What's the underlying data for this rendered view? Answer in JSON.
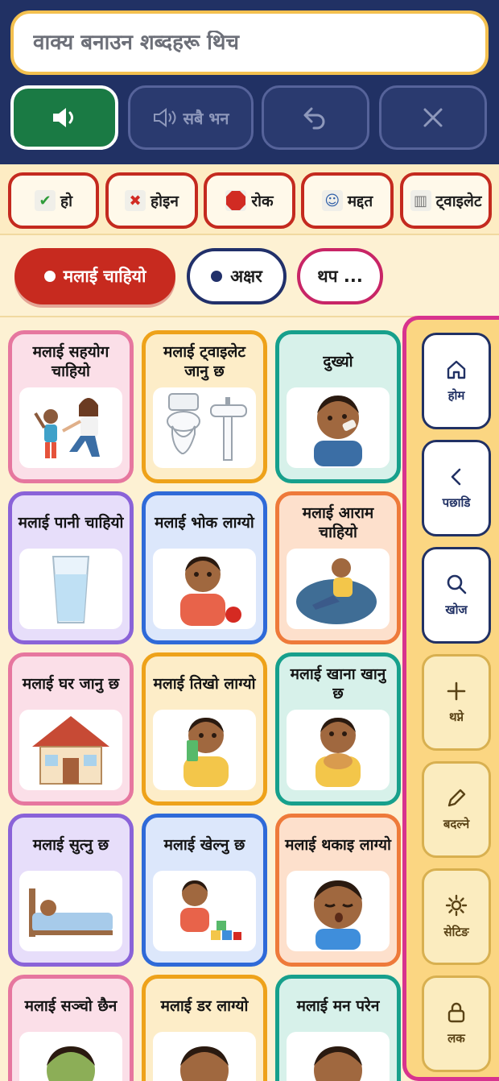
{
  "header": {
    "sentence_placeholder": "वाक्य बनाउन शब्दहरू थिच",
    "speak_all_label": "सबै भन"
  },
  "quick": [
    {
      "label": "हो",
      "icon": "check-icon"
    },
    {
      "label": "होइन",
      "icon": "cross-icon"
    },
    {
      "label": "रोक",
      "icon": "stop-sign-icon"
    },
    {
      "label": "मद्दत",
      "icon": "help-icon"
    },
    {
      "label": "ट्वाइलेट",
      "icon": "toilet-icon"
    }
  ],
  "tabs": [
    {
      "label": "मलाई चाहियो",
      "active": true
    },
    {
      "label": "अक्षर"
    },
    {
      "label": "थप ..."
    }
  ],
  "cards": [
    {
      "label": "मलाई सहयोग चाहियो",
      "color": "pink",
      "icon": "help-people-icon"
    },
    {
      "label": "मलाई ट्वाइलेट जानु छ",
      "color": "orange",
      "icon": "toilet-sink-icon"
    },
    {
      "label": "दुख्यो",
      "color": "teal",
      "icon": "hurt-child-icon"
    },
    {
      "label": "मलाई पानी चाहियो",
      "color": "purple",
      "icon": "water-glass-icon"
    },
    {
      "label": "मलाई भोक लाग्यो",
      "color": "blue",
      "icon": "hungry-child-icon"
    },
    {
      "label": "मलाई आराम चाहियो",
      "color": "coral",
      "icon": "rest-beanbag-icon"
    },
    {
      "label": "मलाई घर जानु छ",
      "color": "pink",
      "icon": "house-icon"
    },
    {
      "label": "मलाई तिखो लाग्यो",
      "color": "orange",
      "icon": "thirsty-child-icon"
    },
    {
      "label": "मलाई खाना खानु छ",
      "color": "teal",
      "icon": "eating-child-icon"
    },
    {
      "label": "मलाई सुत्नु छ",
      "color": "purple",
      "icon": "sleeping-bed-icon"
    },
    {
      "label": "मलाई खेल्नु छ",
      "color": "blue",
      "icon": "playing-blocks-icon"
    },
    {
      "label": "मलाई थकाइ लाग्यो",
      "color": "coral",
      "icon": "tired-child-icon"
    },
    {
      "label": "मलाई सञ्चो छैन",
      "color": "pink",
      "icon": "sick-child-icon"
    },
    {
      "label": "मलाई डर लाग्यो",
      "color": "orange",
      "icon": "scared-child-icon"
    },
    {
      "label": "मलाई मन परेन",
      "color": "teal",
      "icon": "upset-child-icon"
    }
  ],
  "sidebar": [
    {
      "label": "होम",
      "icon": "home-icon",
      "kind": "nav"
    },
    {
      "label": "पछाडि",
      "icon": "chevron-left-icon",
      "kind": "nav"
    },
    {
      "label": "खोज",
      "icon": "search-icon",
      "kind": "nav"
    },
    {
      "label": "थप्ने",
      "icon": "plus-icon",
      "kind": "tool"
    },
    {
      "label": "बदल्ने",
      "icon": "pencil-icon",
      "kind": "tool"
    },
    {
      "label": "सेटिङ",
      "icon": "gear-icon",
      "kind": "tool"
    },
    {
      "label": "लक",
      "icon": "lock-icon",
      "kind": "tool"
    }
  ],
  "colors": {
    "header_bg": "#213164",
    "speak_green": "#1a7a44",
    "quick_border": "#c42a1f",
    "active_tab": "#c72a1f",
    "sidebar_border": "#d8338e"
  }
}
